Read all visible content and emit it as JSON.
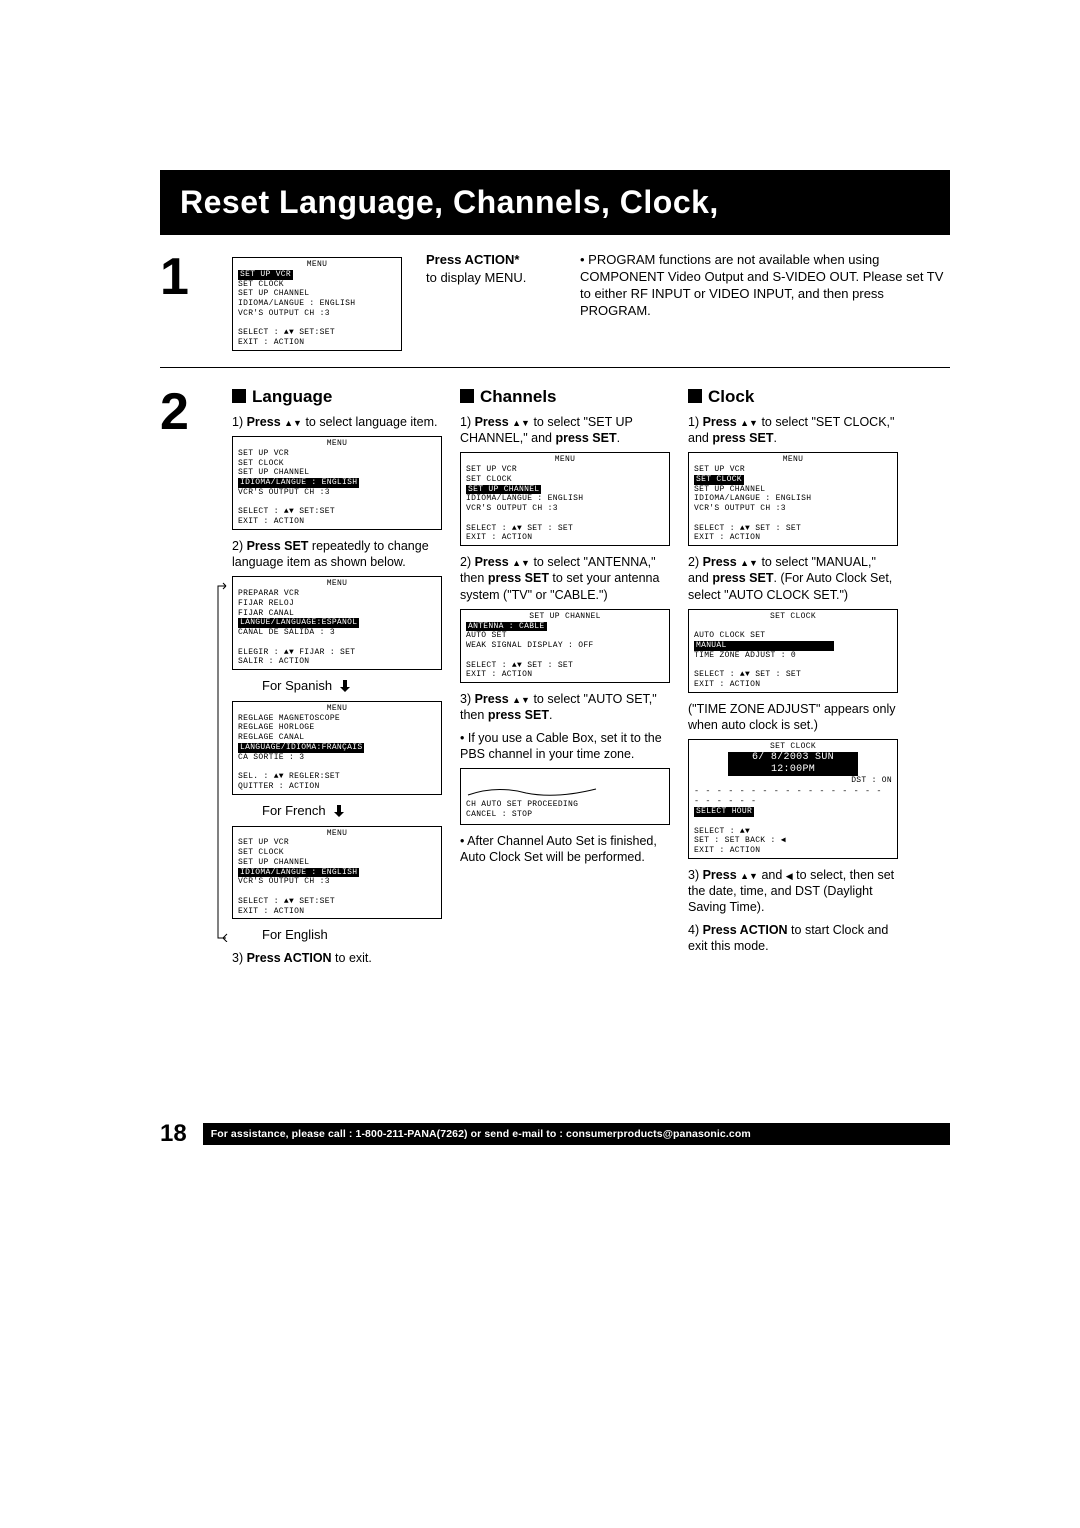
{
  "title": "Reset Language, Channels, Clock,",
  "step1_num": "1",
  "step2_num": "2",
  "osd_menu_title": "MENU",
  "osd1": {
    "l1": "SET  UP  VCR",
    "l2": "SET  CLOCK",
    "l3": "SET  UP  CHANNEL",
    "l4": "IDIOMA/LANGUE : ENGLISH",
    "l5": "VCR'S  OUTPUT  CH :3",
    "f1": "SELECT : ▲▼        SET:SET",
    "f2": "EXIT       : ACTION"
  },
  "step1_mid1": "Press ACTION*",
  "step1_mid2": "to display MENU.",
  "step1_right": "• PROGRAM functions are not available when using COMPONENT Video Output and S-VIDEO OUT. Please set TV to either RF INPUT or VIDEO INPUT, and then press PROGRAM.",
  "lang": {
    "head": "Language",
    "s1a": "Press ",
    "s1b": " to select language item.",
    "s2": "Press SET",
    "s2b": " repeatedly to change language item as shown below.",
    "for_spanish": "For Spanish",
    "for_french": "For French",
    "for_english": "For English",
    "s3a": "Press ACTION",
    "s3b": " to exit."
  },
  "osd_lang1": {
    "l1": "SET  UP  VCR",
    "l2": "SET  CLOCK",
    "l3": "SET  UP  CHANNEL",
    "hl": "IDIOMA/LANGUE : ENGLISH",
    "l5": "VCR'S  OUTPUT  CH :3",
    "f1": "SELECT : ▲▼        SET:SET",
    "f2": "EXIT       : ACTION"
  },
  "osd_lang_es": {
    "l1": "PREPARAR VCR",
    "l2": "FIJAR  RELOJ",
    "l3": "FIJAR  CANAL",
    "hl": "LANGUE/LANGUAGE:ESPAÑOL",
    "l5": "CANAL DE SALIDA : 3",
    "f1": "ELEGIR : ▲▼   FIJAR : SET",
    "f2": "SALIR    : ACTION"
  },
  "osd_lang_fr": {
    "l1": "REGLAGE MAGNETOSCOPE",
    "l2": "REGLAGE HORLOGE",
    "l3": "REGLAGE CANAL",
    "hl": "LANGUAGE/IDIOMA:FRANÇAIS",
    "l5": "CA SORTIE : 3",
    "f1": "SEL.       : ▲▼  REGLER:SET",
    "f2": "QUITTER : ACTION"
  },
  "osd_lang_en": {
    "l1": "SET  UP  VCR",
    "l2": "SET  CLOCK",
    "l3": "SET  UP  CHANNEL",
    "hl": "IDIOMA/LANGUE : ENGLISH",
    "l5": "VCR'S  OUTPUT  CH :3",
    "f1": "SELECT : ▲▼        SET:SET",
    "f2": "EXIT       : ACTION"
  },
  "ch": {
    "head": "Channels",
    "s1a": "Press ",
    "s1b": " to select \"SET UP CHANNEL,\" and ",
    "s1c": "press SET",
    "s2a": "Press ",
    "s2b": " to select \"ANTENNA,\" then ",
    "s2c": "press SET",
    "s2d": " to set your antenna system (\"TV\" or \"CABLE.\")",
    "s3a": "Press ",
    "s3b": " to select \"AUTO SET,\" then ",
    "s3c": "press SET",
    "note1": "• If you use a Cable Box, set it to the PBS channel in your time zone.",
    "note2": "• After Channel Auto Set is finished, Auto Clock Set will be performed."
  },
  "osd_ch1": {
    "l1": "SET  UP  VCR",
    "l2": "SET  CLOCK",
    "hl": "SET  UP  CHANNEL",
    "l4": "IDIOMA/LANGUE : ENGLISH",
    "l5": "VCR'S  OUTPUT  CH :3",
    "f1": "SELECT : ▲▼     SET : SET",
    "f2": "EXIT       : ACTION"
  },
  "osd_ch2": {
    "title": "SET  UP  CHANNEL",
    "hl": "ANTENNA   :  CABLE",
    "l2": "AUTO  SET",
    "l3": "WEAK  SIGNAL  DISPLAY : OFF",
    "f1": "SELECT : ▲▼     SET : SET",
    "f2": "EXIT       : ACTION"
  },
  "osd_ch3": {
    "l1": "CH  AUTO  SET  PROCEEDING",
    "l2": "CANCEL : STOP"
  },
  "clk": {
    "head": "Clock",
    "s1a": "Press ",
    "s1b": " to select \"SET CLOCK,\" and ",
    "s1c": "press SET",
    "s2a": "Press ",
    "s2b": " to select \"MANUAL,\" and ",
    "s2c": "press SET",
    "s2d": ". (For Auto Clock Set, select \"AUTO CLOCK SET.\")",
    "note1": "(\"TIME ZONE ADJUST\" appears only when auto clock is set.)",
    "s3a": "Press ",
    "s3b": " and ",
    "s3c": " to select, then set the date, time, and DST (Daylight Saving Time).",
    "s4a": "Press ACTION",
    "s4b": " to start Clock and exit this mode."
  },
  "osd_clk1": {
    "l1": "SET  UP  VCR",
    "hl": "SET  CLOCK",
    "l3": "SET  UP  CHANNEL",
    "l4": "IDIOMA/LANGUE : ENGLISH",
    "l5": "VCR'S  OUTPUT  CH :3",
    "f1": "SELECT : ▲▼     SET : SET",
    "f2": "EXIT       : ACTION"
  },
  "osd_clk2": {
    "title": "SET  CLOCK",
    "l1": "AUTO  CLOCK  SET",
    "hl": "MANUAL",
    "l3": "TIME  ZONE  ADJUST   :   0",
    "f1": "SELECT : ▲▼     SET : SET",
    "f2": "EXIT       : ACTION"
  },
  "osd_clk3": {
    "title": "SET  CLOCK",
    "hl": " 6/ 8/2003 SUN 12:00PM",
    "dst": "DST : ON",
    "dash": "- - - - - - - - - - - - - - - - - - - - - - -",
    "sel": "SELECT  HOUR",
    "f1": "SELECT : ▲▼",
    "f2": "SET       : SET        BACK : ◀",
    "f3": "EXIT      : ACTION"
  },
  "footer": {
    "page": "18",
    "text": "For assistance, please call : 1-800-211-PANA(7262) or send e-mail to : consumerproducts@panasonic.com"
  }
}
